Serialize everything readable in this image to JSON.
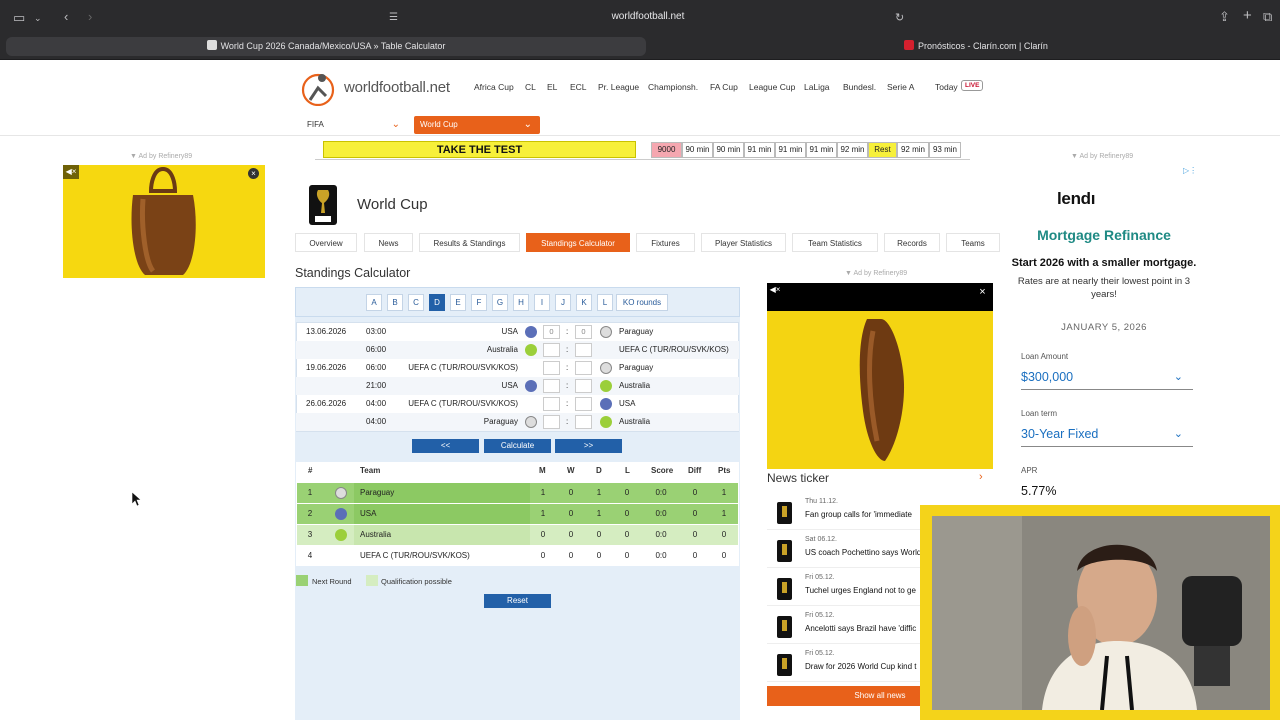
{
  "browser": {
    "url": "worldfootball.net",
    "tabs": [
      {
        "label": "World Cup 2026 Canada/Mexico/USA » Table Calculator"
      },
      {
        "label": "Pronósticos - Clarín.com | Clarín"
      }
    ]
  },
  "site": {
    "logo": "worldfootball.net",
    "nav": [
      "Africa Cup",
      "CL",
      "EL",
      "ECL",
      "Pr. League",
      "Championsh.",
      "FA Cup",
      "League Cup",
      "LaLiga",
      "Bundesl.",
      "Serie A",
      "Today"
    ],
    "live_badge": "LIVE",
    "select_org": "FIFA",
    "select_comp": "World Cup"
  },
  "banner": {
    "test_button": "TAKE THE TEST",
    "cells": [
      "9000",
      "90 min",
      "90 min",
      "91 min",
      "91 min",
      "91 min",
      "92 min",
      "Rest",
      "92 min",
      "93 min"
    ]
  },
  "ads": {
    "label": "▼ Ad by Refinery89",
    "mortgage": {
      "brand": "lendı",
      "title": "Mortgage Refinance",
      "subtitle": "Start 2026 with a smaller mortgage.",
      "desc": "Rates are at nearly their lowest point in 3 years!",
      "date": "JANUARY 5, 2026",
      "loan_amount_label": "Loan Amount",
      "loan_amount": "$300,000",
      "loan_term_label": "Loan term",
      "loan_term": "30-Year Fixed",
      "apr_label": "APR",
      "apr": "5.77%"
    }
  },
  "page": {
    "title": "World Cup",
    "tabs": [
      "Overview",
      "News",
      "Results & Standings",
      "Standings Calculator",
      "Fixtures",
      "Player Statistics",
      "Team Statistics",
      "Records",
      "Teams"
    ],
    "section_title": "Standings Calculator"
  },
  "groups": {
    "letters": [
      "A",
      "B",
      "C",
      "D",
      "E",
      "F",
      "G",
      "H",
      "I",
      "J",
      "K",
      "L"
    ],
    "active": "D",
    "ko": "KO rounds"
  },
  "fixtures": [
    {
      "date": "13.06.2026",
      "time": "03:00",
      "home": "USA",
      "away": "Paraguay",
      "hs": "0",
      "as": "0"
    },
    {
      "date": "",
      "time": "06:00",
      "home": "Australia",
      "away": "UEFA C (TUR/ROU/SVK/KOS)",
      "hs": "",
      "as": ""
    },
    {
      "date": "19.06.2026",
      "time": "06:00",
      "home": "UEFA C (TUR/ROU/SVK/KOS)",
      "away": "Paraguay",
      "hs": "",
      "as": ""
    },
    {
      "date": "",
      "time": "21:00",
      "home": "USA",
      "away": "Australia",
      "hs": "",
      "as": ""
    },
    {
      "date": "26.06.2026",
      "time": "04:00",
      "home": "UEFA C (TUR/ROU/SVK/KOS)",
      "away": "USA",
      "hs": "",
      "as": ""
    },
    {
      "date": "",
      "time": "04:00",
      "home": "Paraguay",
      "away": "Australia",
      "hs": "",
      "as": ""
    }
  ],
  "calc_buttons": {
    "prev": "<<",
    "calc": "Calculate",
    "next": ">>",
    "reset": "Reset"
  },
  "standings": {
    "headers": [
      "#",
      "Team",
      "M",
      "W",
      "D",
      "L",
      "Score",
      "Diff",
      "Pts"
    ],
    "rows": [
      {
        "pos": "1",
        "team": "Paraguay",
        "m": "1",
        "w": "0",
        "d": "1",
        "l": "0",
        "score": "0:0",
        "diff": "0",
        "pts": "1",
        "status": "next"
      },
      {
        "pos": "2",
        "team": "USA",
        "m": "1",
        "w": "0",
        "d": "1",
        "l": "0",
        "score": "0:0",
        "diff": "0",
        "pts": "1",
        "status": "next"
      },
      {
        "pos": "3",
        "team": "Australia",
        "m": "0",
        "w": "0",
        "d": "0",
        "l": "0",
        "score": "0:0",
        "diff": "0",
        "pts": "0",
        "status": "qual"
      },
      {
        "pos": "4",
        "team": "UEFA C (TUR/ROU/SVK/KOS)",
        "m": "0",
        "w": "0",
        "d": "0",
        "l": "0",
        "score": "0:0",
        "diff": "0",
        "pts": "0",
        "status": "none"
      }
    ],
    "legend_next": "Next Round",
    "legend_qual": "Qualification possible"
  },
  "news": {
    "title": "News ticker",
    "items": [
      {
        "date": "Thu 11.12.",
        "headline": "Fan group calls for 'immediate"
      },
      {
        "date": "Sat 06.12.",
        "headline": "US coach Pochettino says World"
      },
      {
        "date": "Fri 05.12.",
        "headline": "Tuchel urges England not to ge"
      },
      {
        "date": "Fri 05.12.",
        "headline": "Ancelotti says Brazil have 'diffic"
      },
      {
        "date": "Fri 05.12.",
        "headline": "Draw for 2026 World Cup kind t"
      }
    ],
    "show_all": "Show all news"
  },
  "colors": {
    "accent": "#e8611a",
    "blue": "#2260a8",
    "next_round": "#9ad174",
    "qualification": "#d5edc1",
    "mortgage": "#1f8a84"
  }
}
